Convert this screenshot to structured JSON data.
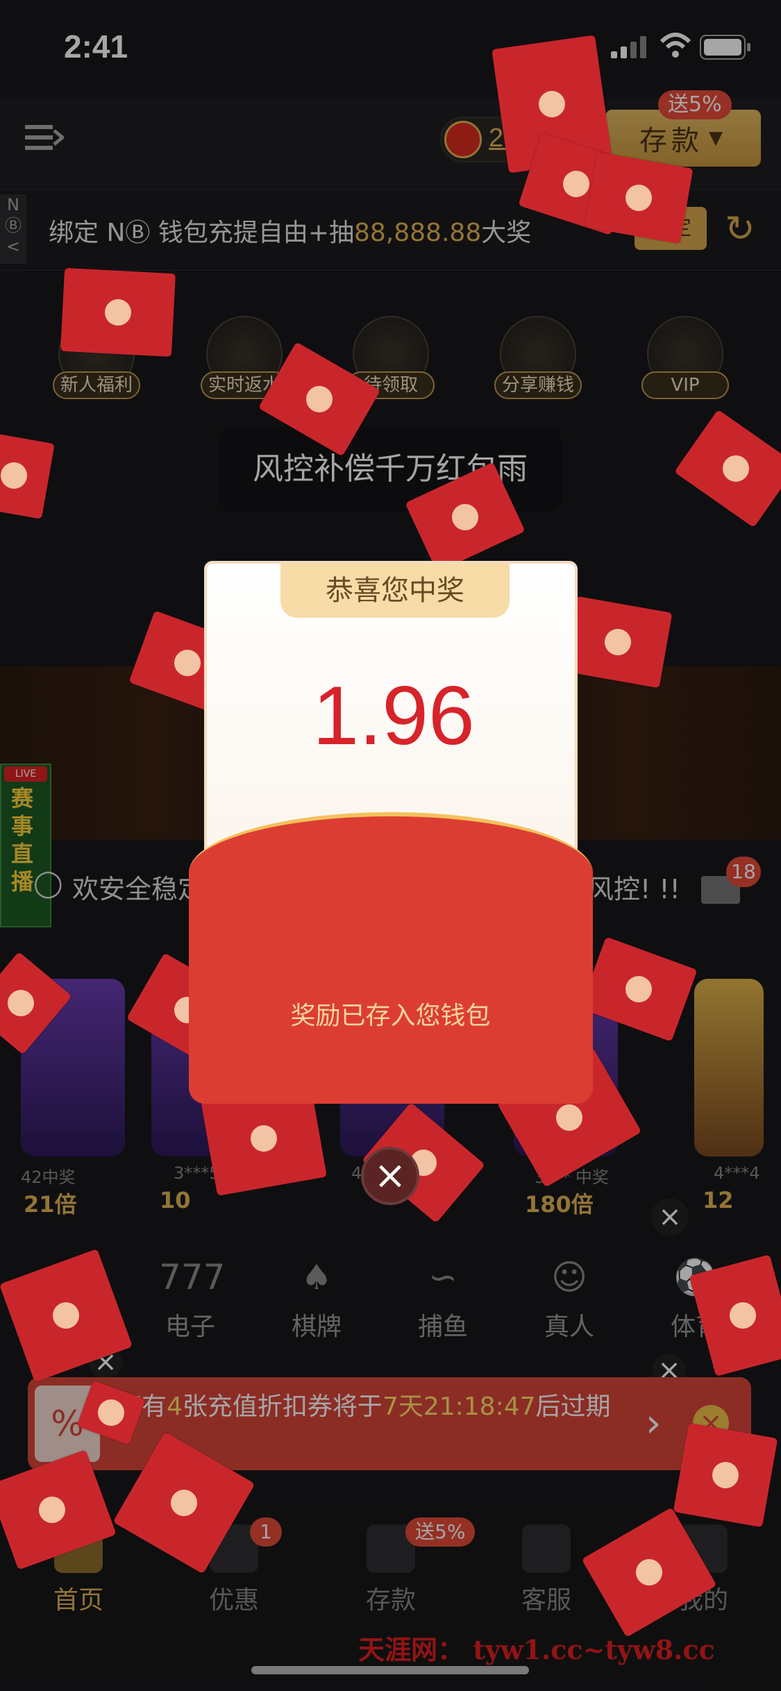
{
  "status": {
    "time": "2:41"
  },
  "header": {
    "balance": "2.15",
    "deposit_label": "存款",
    "deposit_badge": "送5%"
  },
  "bind_bar": {
    "side_tab": "N⃝B<",
    "text_prefix": "绑定 N",
    "text_mid": " 钱包充提自由+抽",
    "amount": "88,888.88",
    "text_suffix": "大奖",
    "button": "绑定"
  },
  "quick_icons": [
    "新人福利",
    "实时返水",
    "待领取",
    "分享赚钱",
    "VIP"
  ],
  "toast": "风控补偿千万红包雨",
  "live": {
    "tag": "LIVE",
    "text": "赛事直播"
  },
  "marquee": {
    "left": "欢安全稳定",
    "right": "风控! !!",
    "mail_count": "18"
  },
  "games": [
    {
      "user": "42中奖",
      "mult": "21倍"
    },
    {
      "user": "3***56",
      "mult": "10"
    },
    {
      "user": "4",
      "mult": ""
    },
    {
      "user": "3*** 中奖",
      "mult": "180倍"
    },
    {
      "user": "4***4",
      "mult": "12"
    }
  ],
  "categories": [
    "电子",
    "棋牌",
    "捕鱼",
    "真人",
    "体育"
  ],
  "coupon": {
    "text_pre": "您有",
    "count": "4",
    "text_mid": "张充值折扣券将于",
    "time": "7天21:18:47",
    "text_post": "后过期"
  },
  "tabs": [
    {
      "label": "首页",
      "active": true
    },
    {
      "label": "优惠",
      "badge": "1"
    },
    {
      "label": "存款",
      "badge": "送5%"
    },
    {
      "label": "客服"
    },
    {
      "label": "我的"
    }
  ],
  "popup": {
    "title": "恭喜您中奖",
    "amount": "1.96",
    "message": "奖励已存入您钱包"
  },
  "watermark": "天涯网： tyw1.cc~tyw8.cc",
  "colors": {
    "gold": "#e3b454",
    "red": "#dc3d33",
    "bg": "#18181b"
  }
}
